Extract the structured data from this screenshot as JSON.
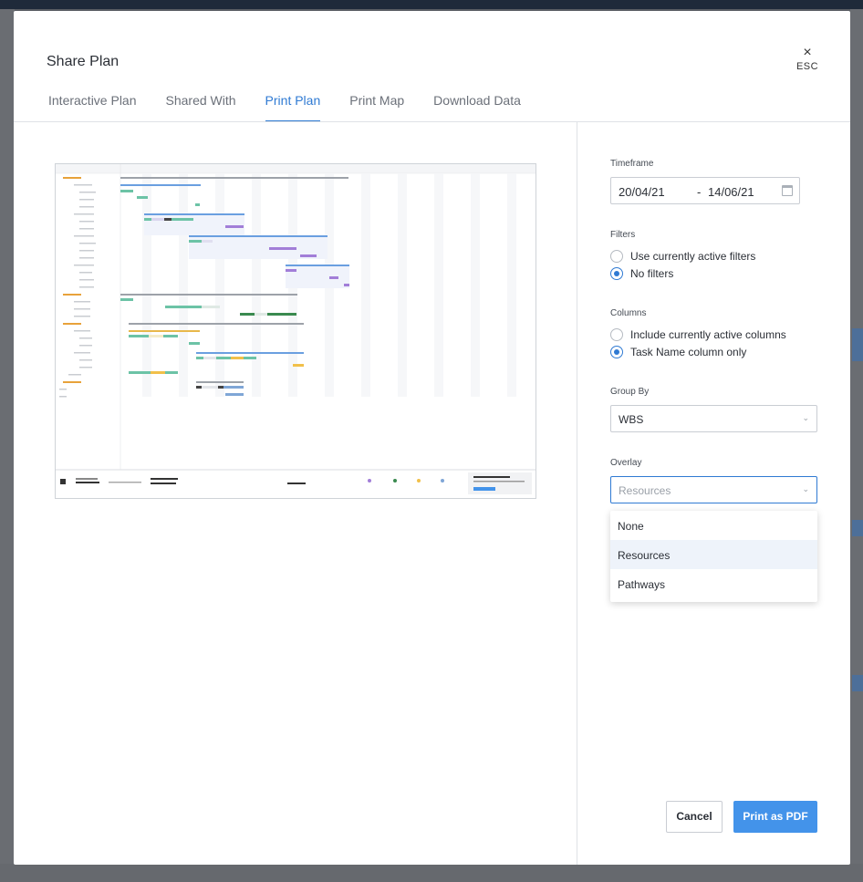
{
  "modal": {
    "title": "Share Plan",
    "close_label": "×",
    "close_hint": "ESC"
  },
  "tabs": [
    {
      "label": "Interactive Plan",
      "active": false
    },
    {
      "label": "Shared With",
      "active": false
    },
    {
      "label": "Print Plan",
      "active": true
    },
    {
      "label": "Print Map",
      "active": false
    },
    {
      "label": "Download Data",
      "active": false
    }
  ],
  "settings": {
    "timeframe": {
      "label": "Timeframe",
      "from": "20/04/21",
      "separator": "-",
      "to": "14/06/21"
    },
    "filters": {
      "label": "Filters",
      "options": [
        {
          "label": "Use currently active filters",
          "checked": false
        },
        {
          "label": "No filters",
          "checked": true
        }
      ]
    },
    "columns": {
      "label": "Columns",
      "options": [
        {
          "label": "Include currently active columns",
          "checked": false
        },
        {
          "label": "Task Name column only",
          "checked": true
        }
      ]
    },
    "group_by": {
      "label": "Group By",
      "value": "WBS"
    },
    "overlay": {
      "label": "Overlay",
      "placeholder": "Resources",
      "options": [
        "None",
        "Resources",
        "Pathways"
      ],
      "highlighted": "Resources"
    }
  },
  "buttons": {
    "cancel": "Cancel",
    "print": "Print as PDF"
  },
  "colors": {
    "accent": "#2f7ad3",
    "primary_button": "#4393ea"
  }
}
